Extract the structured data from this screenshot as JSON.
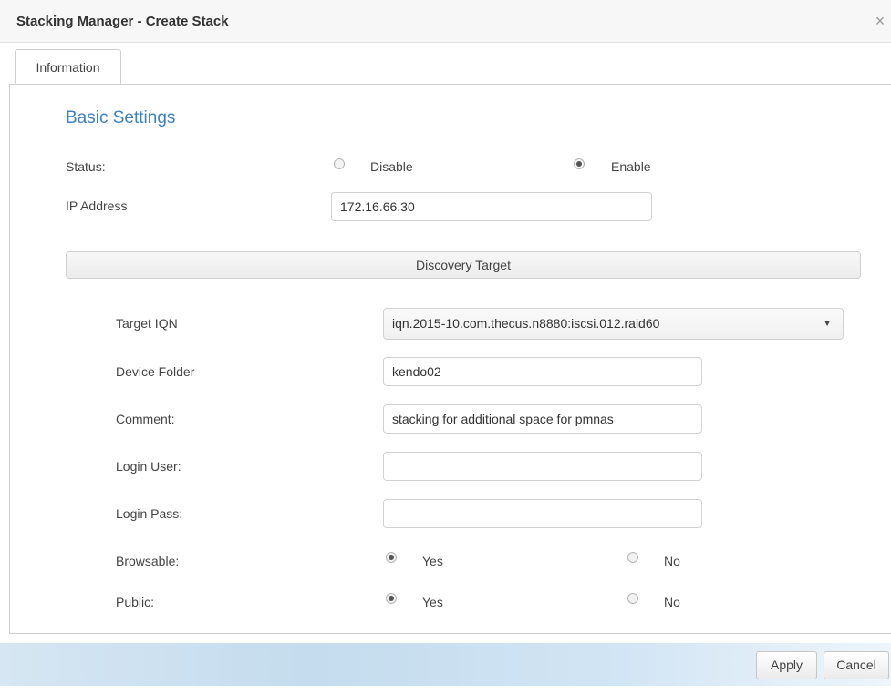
{
  "window": {
    "title": "Stacking Manager - Create Stack",
    "close_glyph": "×"
  },
  "tabs": [
    {
      "label": "Information",
      "active": true
    }
  ],
  "basic_settings": {
    "heading": "Basic Settings",
    "status_label": "Status:",
    "status_options": [
      {
        "label": "Disable",
        "selected": false
      },
      {
        "label": "Enable",
        "selected": true
      }
    ],
    "ip_label": "IP Address",
    "ip_value": "172.16.66.30"
  },
  "discovery": {
    "section_title": "Discovery Target",
    "target_iqn_label": "Target IQN",
    "target_iqn_value": "iqn.2015-10.com.thecus.n8880:iscsi.012.raid60",
    "device_folder_label": "Device Folder",
    "device_folder_value": "kendo02",
    "comment_label": "Comment:",
    "comment_value": "stacking for additional space for pmnas",
    "login_user_label": "Login User:",
    "login_user_value": "",
    "login_pass_label": "Login Pass:",
    "login_pass_value": "",
    "browsable_label": "Browsable:",
    "browsable_options": [
      {
        "label": "Yes",
        "selected": true
      },
      {
        "label": "No",
        "selected": false
      }
    ],
    "public_label": "Public:",
    "public_options": [
      {
        "label": "Yes",
        "selected": true
      },
      {
        "label": "No",
        "selected": false
      }
    ]
  },
  "footer": {
    "apply_label": "Apply",
    "cancel_label": "Cancel"
  },
  "colors": {
    "heading_blue": "#3d82c4",
    "footer_gradient_start": "#d6e6f3",
    "footer_gradient_end": "#eef5fb"
  }
}
